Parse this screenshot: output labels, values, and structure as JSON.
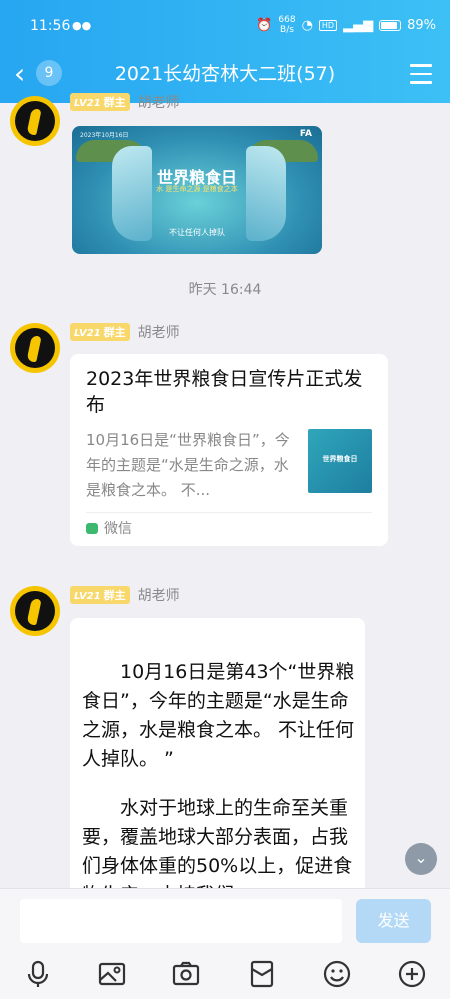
{
  "status_bar": {
    "time": "11:56",
    "net_speed_value": "668",
    "net_speed_unit": "B/s",
    "hd_label": "HD",
    "battery": "89%"
  },
  "nav": {
    "unread_count": "9",
    "title": "2021长幼杏林大二班(57)"
  },
  "messages": {
    "first": {
      "poster_top": "2023年10月16日",
      "poster_logo": "FA",
      "poster_title": "世界粮食日",
      "poster_sub": "水 是生命之源 是粮食之本",
      "poster_bottom": "不让任何人掉队"
    },
    "timestamp": "昨天 16:44",
    "sender_level": "LV21",
    "sender_role": "群主",
    "sender_name": "胡老师",
    "share": {
      "title": "2023年世界粮食日宣传片正式发布",
      "desc": "10月16日是“世界粮食日”，今年的主题是“水是生命之源，水是粮食之本。 不...",
      "thumb_label": "世界粮食日",
      "source": "微信"
    },
    "text": {
      "para1": "10月16日是第43个“世界粮食日”，今年的主题是“水是生命之源，水是粮食之本。 不让任何人掉队。 ”",
      "para2": "水对于地球上的生命至关重要，覆盖地球大部分表面，占我们身体体重的50%以上，促进食物生产，支持我们"
    }
  },
  "input": {
    "send_label": "发送"
  },
  "toolbar": {
    "icons": [
      "microphone-icon",
      "image-icon",
      "camera-icon",
      "red-packet-icon",
      "emoji-icon",
      "plus-icon"
    ]
  }
}
